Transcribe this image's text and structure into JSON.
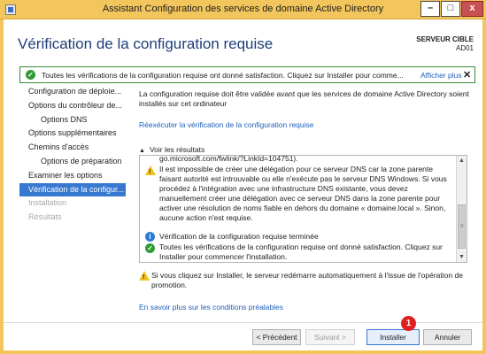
{
  "window": {
    "title": "Assistant Configuration des services de domaine Active Directory",
    "min_glyph": "–",
    "max_glyph": "□",
    "close_glyph": "x"
  },
  "header": {
    "page_title": "Vérification de la configuration requise",
    "server_label": "SERVEUR CIBLE",
    "server_name": "AD01"
  },
  "banner": {
    "message": "Toutes les vérifications de la configuration requise ont donné satisfaction. Cliquez sur Installer pour comme...",
    "more_link": "Afficher plus",
    "close_glyph": "✕"
  },
  "nav": {
    "items": [
      {
        "label": "Configuration de déploie...",
        "level": 0,
        "state": "normal"
      },
      {
        "label": "Options du contrôleur de...",
        "level": 0,
        "state": "normal"
      },
      {
        "label": "Options DNS",
        "level": 1,
        "state": "normal"
      },
      {
        "label": "Options supplémentaires",
        "level": 0,
        "state": "normal"
      },
      {
        "label": "Chemins d'accès",
        "level": 0,
        "state": "normal"
      },
      {
        "label": "Options de préparation",
        "level": 1,
        "state": "normal"
      },
      {
        "label": "Examiner les options",
        "level": 0,
        "state": "normal"
      },
      {
        "label": "Vérification de la configur...",
        "level": 0,
        "state": "active"
      },
      {
        "label": "Installation",
        "level": 0,
        "state": "disabled"
      },
      {
        "label": "Résultats",
        "level": 0,
        "state": "disabled"
      }
    ]
  },
  "main": {
    "description": "La configuration requise doit être validée avant que les services de domaine Active Directory soient installés sur cet ordinateur",
    "rerun_link": "Réexécuter la vérification de la configuration requise",
    "results_header": "Voir les résultats",
    "results": {
      "truncated_line": "go.microsoft.com/fwlink/?LinkId=104751).",
      "warning_text": "Il est impossible de créer une délégation pour ce serveur DNS car la zone parente faisant autorité est introuvable ou elle n'exécute pas le serveur DNS Windows. Si vous procédez à l'intégration avec une infrastructure DNS existante, vous devez manuellement créer une délégation avec ce serveur DNS dans la zone parente pour activer une résolution de noms fiable en dehors du domaine « domaine.local ». Sinon, aucune action n'est requise.",
      "info_text": "Vérification de la configuration requise terminée",
      "success_text": "Toutes les vérifications de la configuration requise ont donné satisfaction. Cliquez sur Installer pour commencer l'installation."
    },
    "reboot_note": "Si vous cliquez sur Installer, le serveur redémarre automatiquement à l'issue de l'opération de promotion.",
    "learn_more_link": "En savoir plus sur les conditions préalables"
  },
  "footer": {
    "prev_label": "< Précédent",
    "next_label": "Suivant >",
    "install_label": "Installer",
    "cancel_label": "Annuler",
    "annotation_number": "1"
  },
  "colors": {
    "title_bar": "#f2c65c",
    "accent": "#3778d0",
    "link": "#1f5fb8",
    "success": "#2f9b35",
    "warning": "#f0c21b",
    "badge": "#e02020"
  },
  "icons": {
    "banner": "success-check-icon",
    "warning": "warning-icon",
    "info": "info-icon",
    "success": "success-check-icon"
  }
}
